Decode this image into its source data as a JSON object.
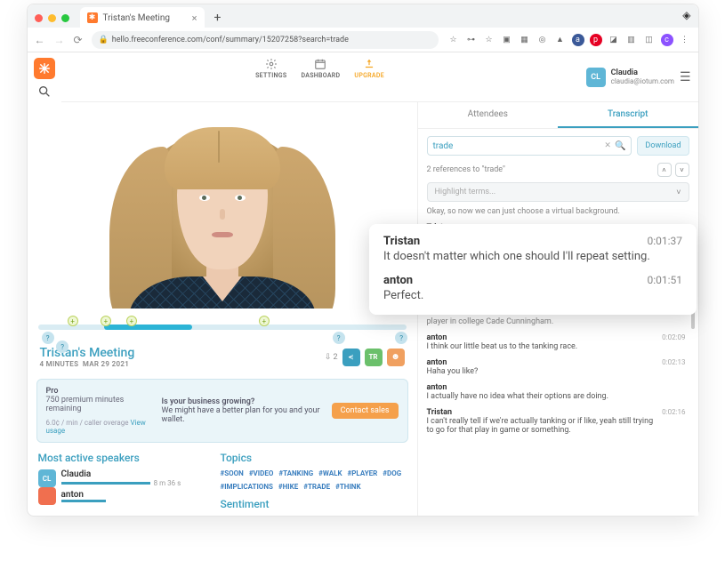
{
  "browser": {
    "tab_title": "Tristan's Meeting",
    "url": "hello.freeconference.com/conf/summary/15207258?search=trade"
  },
  "topbar": {
    "settings": "SETTINGS",
    "dashboard": "DASHBOARD",
    "upgrade": "UPGRADE"
  },
  "user": {
    "initials": "CL",
    "name": "Claudia",
    "email": "claudia@iotum.com",
    "avatar_color": "#5fb6d6"
  },
  "meeting": {
    "title": "Tristan's Meeting",
    "duration": "4 MINUTES",
    "date": "MAR 29 2021",
    "download_count": "2",
    "tr_badge": "TR"
  },
  "promo": {
    "plan": "Pro",
    "minutes": "750 premium minutes remaining",
    "rate": "6.0¢ / min / caller overage ",
    "view_usage": "View usage",
    "q": "Is your business growing?",
    "sub": "We might have a better plan for you and your wallet.",
    "cta": "Contact sales"
  },
  "speakers_heading": "Most active speakers",
  "speakers": [
    {
      "initials": "CL",
      "name": "Claudia",
      "dur": "8 m 36 s",
      "color": "#5fb6d6",
      "bar": 60
    },
    {
      "initials": "",
      "name": "anton",
      "dur": "",
      "color": "#f06f4f",
      "bar": 30
    }
  ],
  "topics_heading": "Topics",
  "topics": [
    "#SOON",
    "#VIDEO",
    "#TANKING",
    "#WALK",
    "#PLAYER",
    "#DOG",
    "#IMPLICATIONS",
    "#HIKE",
    "#TRADE",
    "#THINK"
  ],
  "sentiment_heading": "Sentiment",
  "right_panel": {
    "tab_attendees": "Attendees",
    "tab_transcript": "Transcript",
    "search_value": "trade",
    "download": "Download",
    "refs_text": "2 references to \"trade\"",
    "highlight_placeholder": "Highlight terms..."
  },
  "transcript": [
    {
      "name": "",
      "text": "Okay, so now we can just choose a virtual background.",
      "time": "",
      "sys": true
    },
    {
      "name": "Tristan",
      "text": "It doesn't matter which one should I'll repeat setting.",
      "time": "0:01:37"
    },
    {
      "name": "",
      "text": "player in college Cade Cunningham.",
      "time": "",
      "sys": true
    },
    {
      "name": "anton",
      "text": "I think our little beat us to the tanking race.",
      "time": "0:02:09"
    },
    {
      "name": "anton",
      "text": "Haha you like?",
      "time": "0:02:13"
    },
    {
      "name": "anton",
      "text": "I actually have no idea what their options are doing.",
      "time": ""
    },
    {
      "name": "Tristan",
      "text": "I can't really tell if we're actually tanking or if like, yeah still trying to go for that play in game or something.",
      "time": "0:02:16"
    }
  ],
  "popup": [
    {
      "name": "Tristan",
      "time": "0:01:37",
      "text": "It doesn't matter which one should I'll repeat setting."
    },
    {
      "name": "anton",
      "time": "0:01:51",
      "text": "Perfect."
    }
  ],
  "colors": {
    "accent": "#3b9fbf",
    "orange": "#f5a04b"
  }
}
